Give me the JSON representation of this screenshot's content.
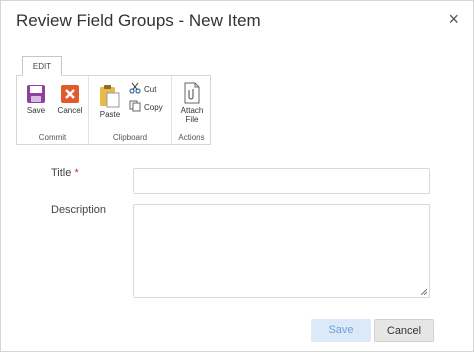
{
  "dialog": {
    "title": "Review Field Groups - New Item",
    "close_glyph": "×"
  },
  "ribbon": {
    "tab_label": "EDIT",
    "groups": {
      "commit": {
        "label": "Commit",
        "save": {
          "label": "Save",
          "icon": "save-icon"
        },
        "cancel": {
          "label": "Cancel",
          "icon": "cancel-icon"
        }
      },
      "clipboard": {
        "label": "Clipboard",
        "paste": {
          "label": "Paste",
          "icon": "paste-icon"
        },
        "cut": {
          "label": "Cut",
          "icon": "scissors-icon"
        },
        "copy": {
          "label": "Copy",
          "icon": "copy-icon"
        }
      },
      "actions": {
        "label": "Actions",
        "attach_line1": "Attach",
        "attach_line2": "File"
      }
    }
  },
  "form": {
    "title_label": "Title",
    "required_marker": "*",
    "title_value": "",
    "description_label": "Description",
    "description_value": ""
  },
  "footer": {
    "save_label": "Save",
    "cancel_label": "Cancel"
  },
  "colors": {
    "save_icon": "#8e3fa0",
    "cancel_icon": "#e05a2b",
    "primary_disabled_bg": "#dbe9f9",
    "primary_disabled_text": "#6aa2dc"
  }
}
